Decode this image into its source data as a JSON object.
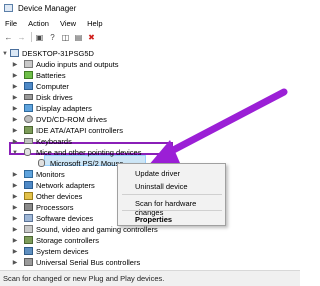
{
  "window": {
    "title": "Device Manager"
  },
  "menu": {
    "items": [
      "File",
      "Action",
      "View",
      "Help"
    ]
  },
  "toolbar": {
    "buttons": [
      "back-icon",
      "forward-icon",
      "properties-icon",
      "help-icon",
      "update-icon",
      "scan-icon",
      "uninstall-icon"
    ]
  },
  "tree": {
    "root": "DESKTOP-31PSG5D",
    "items": [
      {
        "label": "Audio inputs and outputs",
        "expanded": false
      },
      {
        "label": "Batteries",
        "expanded": false
      },
      {
        "label": "Computer",
        "expanded": false
      },
      {
        "label": "Disk drives",
        "expanded": false
      },
      {
        "label": "Display adapters",
        "expanded": false
      },
      {
        "label": "DVD/CD-ROM drives",
        "expanded": false
      },
      {
        "label": "IDE ATA/ATAPI controllers",
        "expanded": false
      },
      {
        "label": "Keyboards",
        "expanded": false
      },
      {
        "label": "Mice and other pointing devices",
        "expanded": true
      },
      {
        "label": "Microsoft PS/2 Mouse",
        "child": true
      },
      {
        "label": "Monitors",
        "expanded": false
      },
      {
        "label": "Network adapters",
        "expanded": false
      },
      {
        "label": "Other devices",
        "expanded": false
      },
      {
        "label": "Processors",
        "expanded": false
      },
      {
        "label": "Software devices",
        "expanded": false
      },
      {
        "label": "Sound, video and gaming controllers",
        "expanded": false
      },
      {
        "label": "Storage controllers",
        "expanded": false
      },
      {
        "label": "System devices",
        "expanded": false
      },
      {
        "label": "Universal Serial Bus controllers",
        "expanded": false
      }
    ]
  },
  "context_menu": {
    "update_driver": "Update driver",
    "uninstall_device": "Uninstall device",
    "scan": "Scan for hardware changes",
    "properties": "Properties"
  },
  "status": {
    "text": "Scan for changed or new Plug and Play devices."
  },
  "colors": {
    "highlight_box": "#8a1fb8",
    "annotation_arrow": "#9b1fd6",
    "selection": "#cde6f7"
  }
}
